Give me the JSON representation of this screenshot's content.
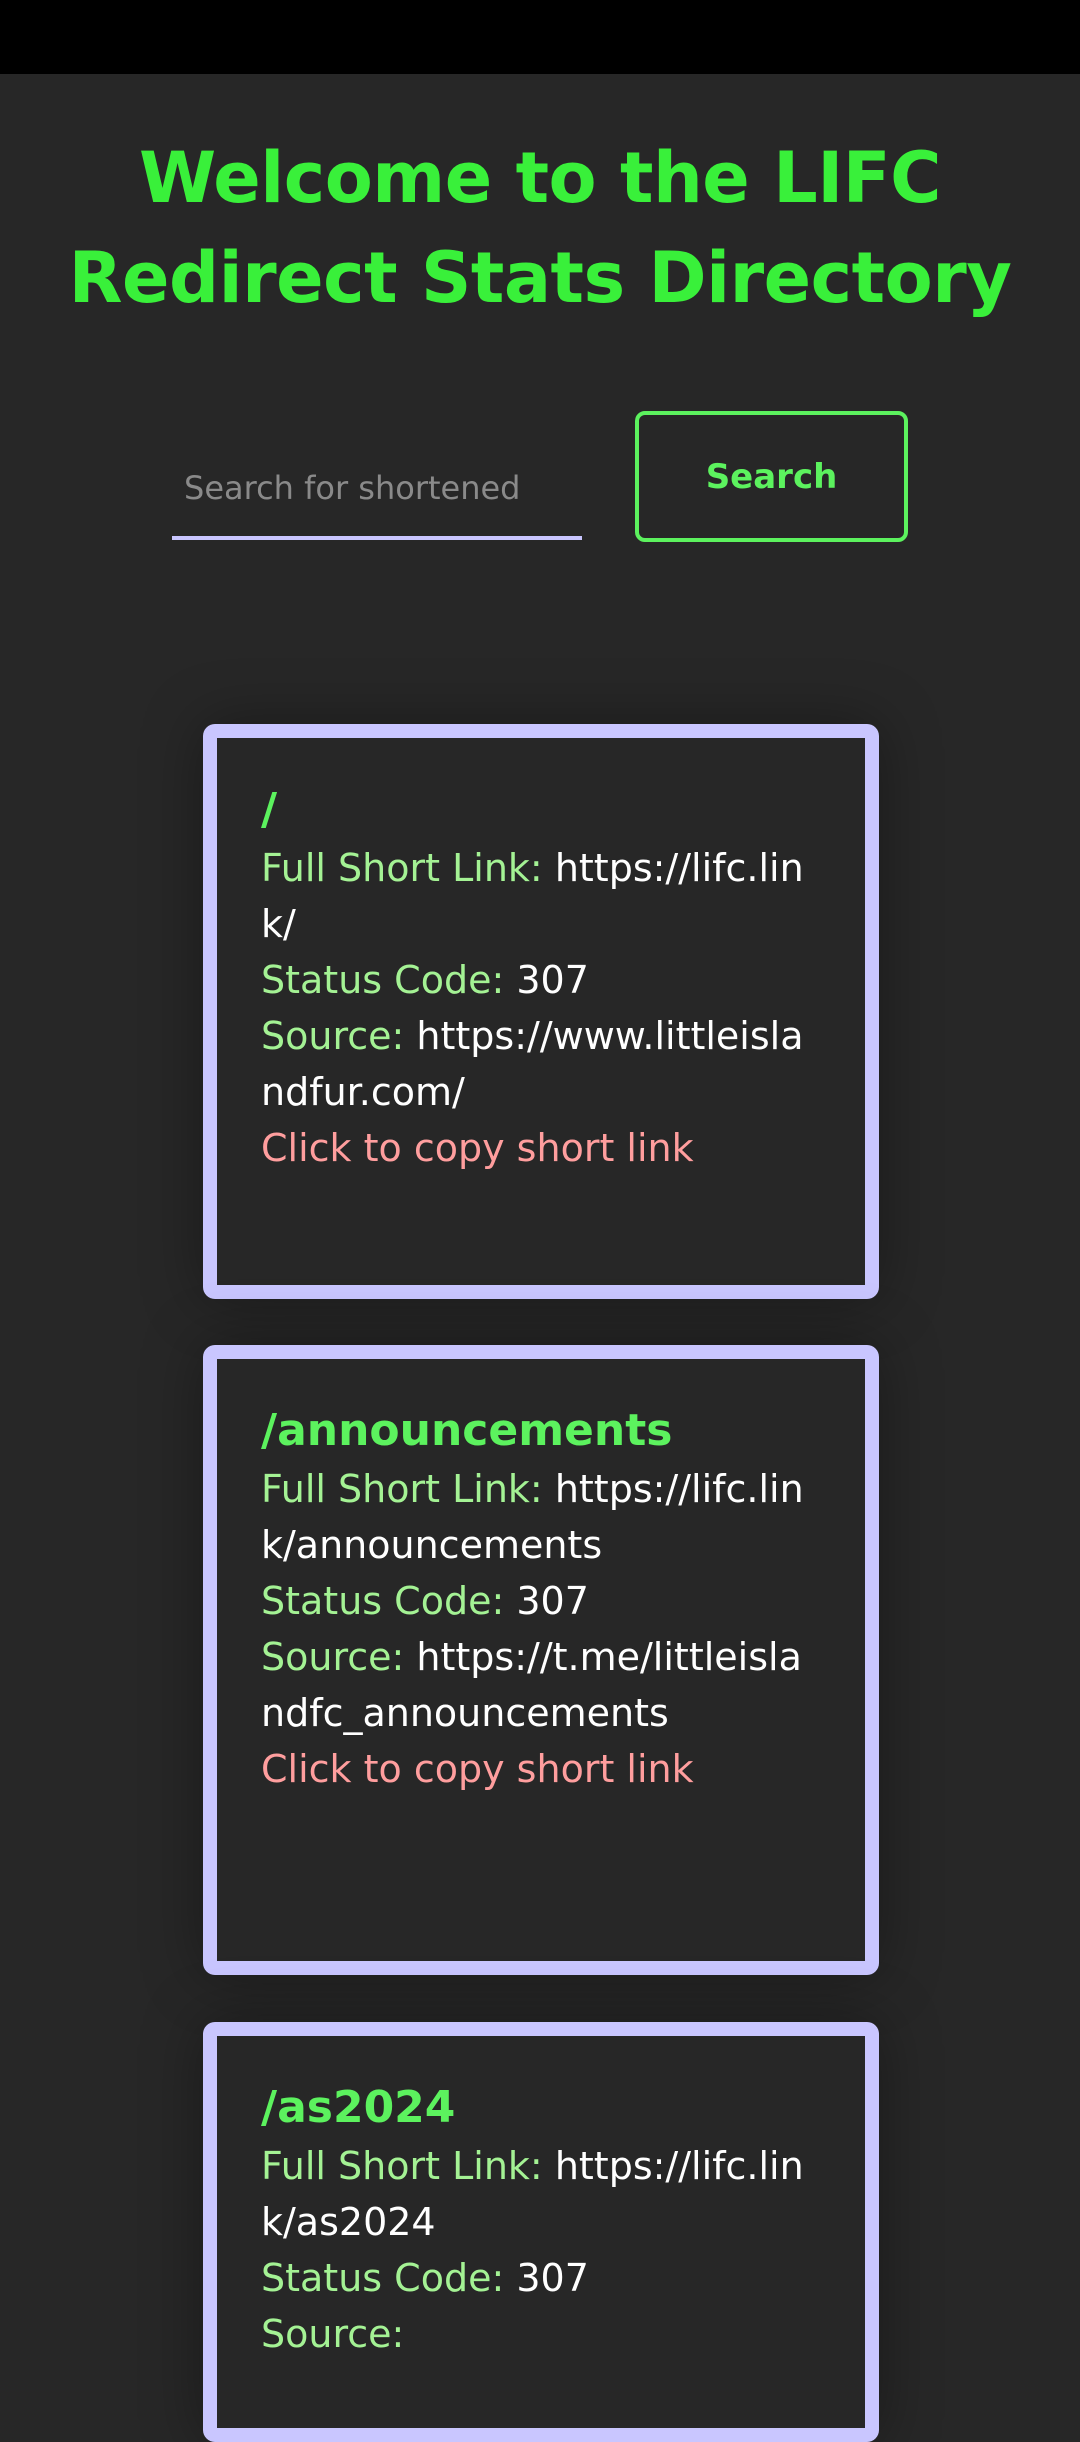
{
  "header": {
    "title": "Welcome to the LIFC Redirect Stats Directory"
  },
  "search": {
    "placeholder": "Search for shortened",
    "value": "",
    "button_label": "Search"
  },
  "colors": {
    "background": "#272727",
    "title_green": "#39f03a",
    "label_green": "#a4f294",
    "card_border": "#c9c6ff",
    "copy_red": "#ff9e9e"
  },
  "labels": {
    "full_short_link": "Full Short Link:",
    "status_code": "Status Code:",
    "source": "Source:",
    "copy": "Click to copy short link"
  },
  "links": [
    {
      "path": "/",
      "short_link": "https://lifc.link/",
      "status_code": "307",
      "source": "https://www.littleislandfur.com/"
    },
    {
      "path": "/announcements",
      "short_link": "https://lifc.link/announcements",
      "status_code": "307",
      "source": "https://t.me/littleislandfc_announcements"
    },
    {
      "path": "/as2024",
      "short_link": "https://lifc.link/as2024",
      "status_code": "307",
      "source": ""
    }
  ]
}
